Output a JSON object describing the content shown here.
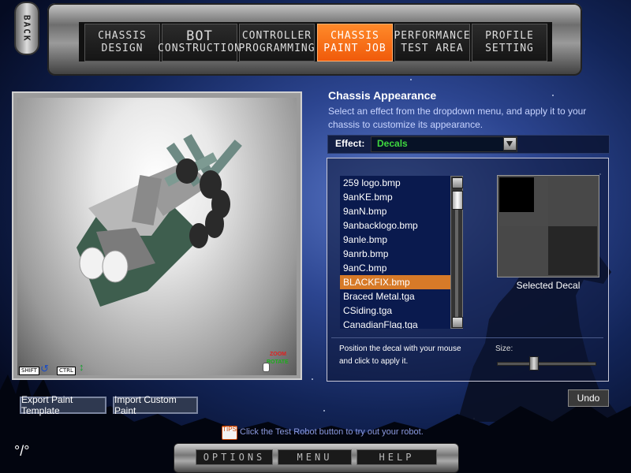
{
  "nav": {
    "back_label": "BACK",
    "tabs": [
      {
        "line1": "CHASSIS",
        "line2": "DESIGN",
        "active": false
      },
      {
        "line1": "BOT",
        "line2": "CONSTRUCTION",
        "active": false
      },
      {
        "line1": "CONTROLLER",
        "line2": "PROGRAMMING",
        "active": false
      },
      {
        "line1": "CHASSIS",
        "line2": "PAINT JOB",
        "active": true
      },
      {
        "line1": "PERFORMANCE",
        "line2": "TEST AREA",
        "active": false
      },
      {
        "line1": "PROFILE",
        "line2": "SETTING",
        "active": false
      }
    ]
  },
  "viewport": {
    "shift_label": "SHIFT",
    "ctrl_label": "CTRL",
    "zoom_label": "ZOOM",
    "rotate_label": "ROTATE"
  },
  "appearance": {
    "title": "Chassis Appearance",
    "description": "Select an effect from the dropdown menu, and apply it to your chassis to customize its appearance.",
    "effect_label": "Effect:",
    "effect_value": "Decals"
  },
  "decals": {
    "files": [
      "259 logo.bmp",
      "9anKE.bmp",
      "9anN.bmp",
      "9anbacklogo.bmp",
      "9anle.bmp",
      "9anrb.bmp",
      "9anC.bmp",
      "BLACKFIX.bmp",
      "Braced Metal.tga",
      "CSiding.tga",
      "CanadianFlag.tga"
    ],
    "selected_index": 7,
    "preview_caption": "Selected Decal",
    "hint": "Position the decal with your mouse and click to apply it.",
    "size_label": "Size:",
    "size_level": 0.36
  },
  "buttons": {
    "undo": "Undo",
    "export": "Export Paint Template",
    "import": "Import Custom Paint"
  },
  "tip": {
    "icon_text": "TIPS",
    "text": "Click the Test Robot button to try out your robot."
  },
  "bottom": {
    "options": "OPTIONS",
    "menu": "MENU",
    "help": "HELP"
  },
  "colors": {
    "active_tab": "#f05a0a",
    "effect_value": "#3fd83f",
    "selected_row": "#d77a28"
  }
}
